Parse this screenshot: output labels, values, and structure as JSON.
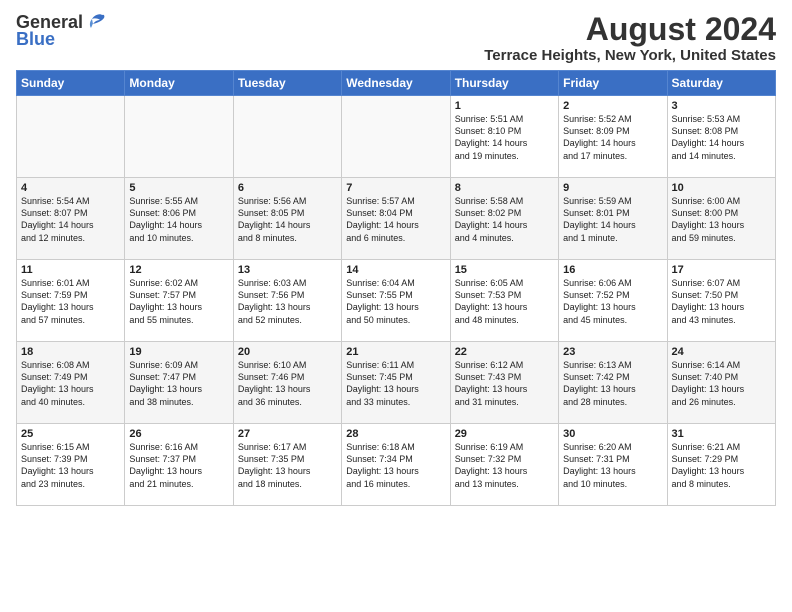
{
  "header": {
    "logo_general": "General",
    "logo_blue": "Blue",
    "month_title": "August 2024",
    "location": "Terrace Heights, New York, United States"
  },
  "days_of_week": [
    "Sunday",
    "Monday",
    "Tuesday",
    "Wednesday",
    "Thursday",
    "Friday",
    "Saturday"
  ],
  "weeks": [
    [
      {
        "day": "",
        "info": ""
      },
      {
        "day": "",
        "info": ""
      },
      {
        "day": "",
        "info": ""
      },
      {
        "day": "",
        "info": ""
      },
      {
        "day": "1",
        "info": "Sunrise: 5:51 AM\nSunset: 8:10 PM\nDaylight: 14 hours\nand 19 minutes."
      },
      {
        "day": "2",
        "info": "Sunrise: 5:52 AM\nSunset: 8:09 PM\nDaylight: 14 hours\nand 17 minutes."
      },
      {
        "day": "3",
        "info": "Sunrise: 5:53 AM\nSunset: 8:08 PM\nDaylight: 14 hours\nand 14 minutes."
      }
    ],
    [
      {
        "day": "4",
        "info": "Sunrise: 5:54 AM\nSunset: 8:07 PM\nDaylight: 14 hours\nand 12 minutes."
      },
      {
        "day": "5",
        "info": "Sunrise: 5:55 AM\nSunset: 8:06 PM\nDaylight: 14 hours\nand 10 minutes."
      },
      {
        "day": "6",
        "info": "Sunrise: 5:56 AM\nSunset: 8:05 PM\nDaylight: 14 hours\nand 8 minutes."
      },
      {
        "day": "7",
        "info": "Sunrise: 5:57 AM\nSunset: 8:04 PM\nDaylight: 14 hours\nand 6 minutes."
      },
      {
        "day": "8",
        "info": "Sunrise: 5:58 AM\nSunset: 8:02 PM\nDaylight: 14 hours\nand 4 minutes."
      },
      {
        "day": "9",
        "info": "Sunrise: 5:59 AM\nSunset: 8:01 PM\nDaylight: 14 hours\nand 1 minute."
      },
      {
        "day": "10",
        "info": "Sunrise: 6:00 AM\nSunset: 8:00 PM\nDaylight: 13 hours\nand 59 minutes."
      }
    ],
    [
      {
        "day": "11",
        "info": "Sunrise: 6:01 AM\nSunset: 7:59 PM\nDaylight: 13 hours\nand 57 minutes."
      },
      {
        "day": "12",
        "info": "Sunrise: 6:02 AM\nSunset: 7:57 PM\nDaylight: 13 hours\nand 55 minutes."
      },
      {
        "day": "13",
        "info": "Sunrise: 6:03 AM\nSunset: 7:56 PM\nDaylight: 13 hours\nand 52 minutes."
      },
      {
        "day": "14",
        "info": "Sunrise: 6:04 AM\nSunset: 7:55 PM\nDaylight: 13 hours\nand 50 minutes."
      },
      {
        "day": "15",
        "info": "Sunrise: 6:05 AM\nSunset: 7:53 PM\nDaylight: 13 hours\nand 48 minutes."
      },
      {
        "day": "16",
        "info": "Sunrise: 6:06 AM\nSunset: 7:52 PM\nDaylight: 13 hours\nand 45 minutes."
      },
      {
        "day": "17",
        "info": "Sunrise: 6:07 AM\nSunset: 7:50 PM\nDaylight: 13 hours\nand 43 minutes."
      }
    ],
    [
      {
        "day": "18",
        "info": "Sunrise: 6:08 AM\nSunset: 7:49 PM\nDaylight: 13 hours\nand 40 minutes."
      },
      {
        "day": "19",
        "info": "Sunrise: 6:09 AM\nSunset: 7:47 PM\nDaylight: 13 hours\nand 38 minutes."
      },
      {
        "day": "20",
        "info": "Sunrise: 6:10 AM\nSunset: 7:46 PM\nDaylight: 13 hours\nand 36 minutes."
      },
      {
        "day": "21",
        "info": "Sunrise: 6:11 AM\nSunset: 7:45 PM\nDaylight: 13 hours\nand 33 minutes."
      },
      {
        "day": "22",
        "info": "Sunrise: 6:12 AM\nSunset: 7:43 PM\nDaylight: 13 hours\nand 31 minutes."
      },
      {
        "day": "23",
        "info": "Sunrise: 6:13 AM\nSunset: 7:42 PM\nDaylight: 13 hours\nand 28 minutes."
      },
      {
        "day": "24",
        "info": "Sunrise: 6:14 AM\nSunset: 7:40 PM\nDaylight: 13 hours\nand 26 minutes."
      }
    ],
    [
      {
        "day": "25",
        "info": "Sunrise: 6:15 AM\nSunset: 7:39 PM\nDaylight: 13 hours\nand 23 minutes."
      },
      {
        "day": "26",
        "info": "Sunrise: 6:16 AM\nSunset: 7:37 PM\nDaylight: 13 hours\nand 21 minutes."
      },
      {
        "day": "27",
        "info": "Sunrise: 6:17 AM\nSunset: 7:35 PM\nDaylight: 13 hours\nand 18 minutes."
      },
      {
        "day": "28",
        "info": "Sunrise: 6:18 AM\nSunset: 7:34 PM\nDaylight: 13 hours\nand 16 minutes."
      },
      {
        "day": "29",
        "info": "Sunrise: 6:19 AM\nSunset: 7:32 PM\nDaylight: 13 hours\nand 13 minutes."
      },
      {
        "day": "30",
        "info": "Sunrise: 6:20 AM\nSunset: 7:31 PM\nDaylight: 13 hours\nand 10 minutes."
      },
      {
        "day": "31",
        "info": "Sunrise: 6:21 AM\nSunset: 7:29 PM\nDaylight: 13 hours\nand 8 minutes."
      }
    ]
  ]
}
